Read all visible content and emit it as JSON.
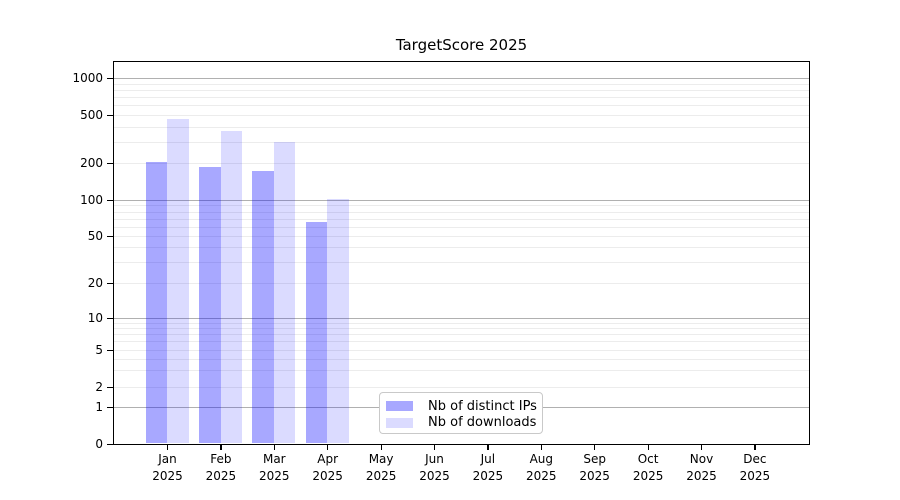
{
  "chart_data": {
    "type": "bar",
    "title": "TargetScore 2025",
    "categories": [
      "Jan",
      "Feb",
      "Mar",
      "Apr",
      "May",
      "Jun",
      "Jul",
      "Aug",
      "Sep",
      "Oct",
      "Nov",
      "Dec"
    ],
    "category_sub_label": "2025",
    "series": [
      {
        "name": "Nb of distinct IPs",
        "color": "rgba(0,0,255,0.34)",
        "values": [
          202,
          186,
          170,
          66,
          0,
          0,
          0,
          0,
          0,
          0,
          0,
          0
        ]
      },
      {
        "name": "Nb of downloads",
        "color": "rgba(0,0,255,0.14)",
        "values": [
          465,
          365,
          300,
          102,
          0,
          0,
          0,
          0,
          0,
          0,
          0,
          0
        ]
      }
    ],
    "yaxis": {
      "scale": "symlog",
      "tick_values": [
        0,
        1,
        2,
        5,
        10,
        20,
        50,
        100,
        200,
        500,
        1000
      ],
      "tick_labels": [
        "0",
        "1",
        "2",
        "5",
        "10",
        "20",
        "50",
        "100",
        "200",
        "500",
        "1000"
      ],
      "major_grid_values": [
        1,
        10,
        100,
        1000
      ],
      "ylim": [
        0,
        1360
      ]
    },
    "xaxis": {
      "year": "2025"
    },
    "legend_position": "lower center",
    "grid": true
  },
  "colors": {
    "minor_grid": "#ececec",
    "major_grid": "#b0b0b0",
    "spine": "#000000",
    "legend_border": "#c9c9c9",
    "text": "#000000"
  }
}
